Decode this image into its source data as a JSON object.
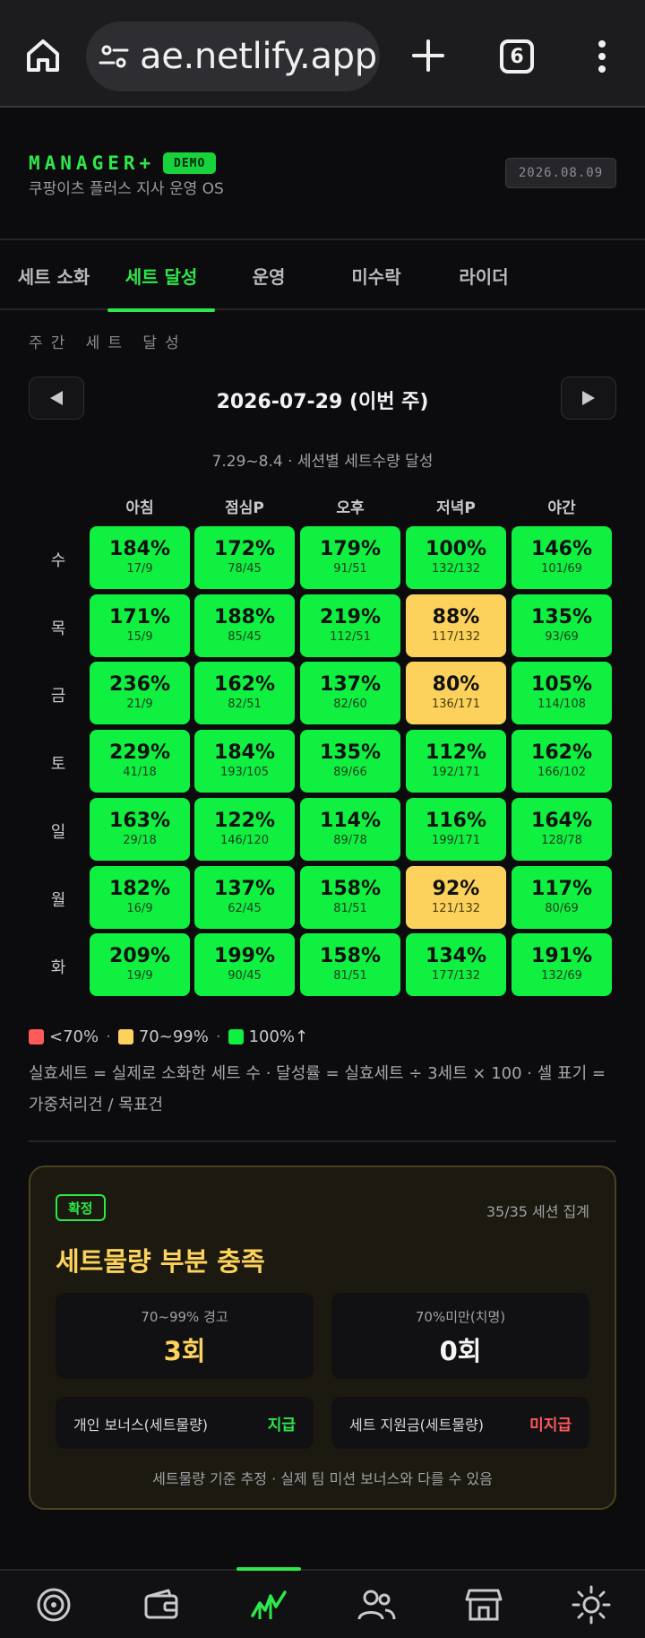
{
  "browser": {
    "url": "ae.netlify.app",
    "tab_count": "6"
  },
  "app": {
    "brand": "MANAGER+",
    "badge": "DEMO",
    "subtitle": "쿠팡이츠 플러스 지사 운영 OS",
    "date": "2026.08.09"
  },
  "tabs": [
    {
      "label": "세트 소화",
      "active": false
    },
    {
      "label": "세트 달성",
      "active": true
    },
    {
      "label": "운영",
      "active": false
    },
    {
      "label": "미수락",
      "active": false
    },
    {
      "label": "라이더",
      "active": false
    }
  ],
  "section": {
    "label": "주간 세트 달성",
    "week_title": "2026-07-29 (이번 주)",
    "range_subtitle": "7.29~8.4 · 세션별 세트수량 달성"
  },
  "grid": {
    "columns": [
      "아침",
      "점심P",
      "오후",
      "저녁P",
      "야간"
    ],
    "rows": [
      {
        "day": "수",
        "cells": [
          {
            "pct": "184%",
            "ratio": "17/9",
            "status": "green"
          },
          {
            "pct": "172%",
            "ratio": "78/45",
            "status": "green"
          },
          {
            "pct": "179%",
            "ratio": "91/51",
            "status": "green"
          },
          {
            "pct": "100%",
            "ratio": "132/132",
            "status": "green"
          },
          {
            "pct": "146%",
            "ratio": "101/69",
            "status": "green"
          }
        ]
      },
      {
        "day": "목",
        "cells": [
          {
            "pct": "171%",
            "ratio": "15/9",
            "status": "green"
          },
          {
            "pct": "188%",
            "ratio": "85/45",
            "status": "green"
          },
          {
            "pct": "219%",
            "ratio": "112/51",
            "status": "green"
          },
          {
            "pct": "88%",
            "ratio": "117/132",
            "status": "yellow"
          },
          {
            "pct": "135%",
            "ratio": "93/69",
            "status": "green"
          }
        ]
      },
      {
        "day": "금",
        "cells": [
          {
            "pct": "236%",
            "ratio": "21/9",
            "status": "green"
          },
          {
            "pct": "162%",
            "ratio": "82/51",
            "status": "green"
          },
          {
            "pct": "137%",
            "ratio": "82/60",
            "status": "green"
          },
          {
            "pct": "80%",
            "ratio": "136/171",
            "status": "yellow"
          },
          {
            "pct": "105%",
            "ratio": "114/108",
            "status": "green"
          }
        ]
      },
      {
        "day": "토",
        "cells": [
          {
            "pct": "229%",
            "ratio": "41/18",
            "status": "green"
          },
          {
            "pct": "184%",
            "ratio": "193/105",
            "status": "green"
          },
          {
            "pct": "135%",
            "ratio": "89/66",
            "status": "green"
          },
          {
            "pct": "112%",
            "ratio": "192/171",
            "status": "green"
          },
          {
            "pct": "162%",
            "ratio": "166/102",
            "status": "green"
          }
        ]
      },
      {
        "day": "일",
        "cells": [
          {
            "pct": "163%",
            "ratio": "29/18",
            "status": "green"
          },
          {
            "pct": "122%",
            "ratio": "146/120",
            "status": "green"
          },
          {
            "pct": "114%",
            "ratio": "89/78",
            "status": "green"
          },
          {
            "pct": "116%",
            "ratio": "199/171",
            "status": "green"
          },
          {
            "pct": "164%",
            "ratio": "128/78",
            "status": "green"
          }
        ]
      },
      {
        "day": "월",
        "cells": [
          {
            "pct": "182%",
            "ratio": "16/9",
            "status": "green"
          },
          {
            "pct": "137%",
            "ratio": "62/45",
            "status": "green"
          },
          {
            "pct": "158%",
            "ratio": "81/51",
            "status": "green"
          },
          {
            "pct": "92%",
            "ratio": "121/132",
            "status": "yellow"
          },
          {
            "pct": "117%",
            "ratio": "80/69",
            "status": "green"
          }
        ]
      },
      {
        "day": "화",
        "cells": [
          {
            "pct": "209%",
            "ratio": "19/9",
            "status": "green"
          },
          {
            "pct": "199%",
            "ratio": "90/45",
            "status": "green"
          },
          {
            "pct": "158%",
            "ratio": "81/51",
            "status": "green"
          },
          {
            "pct": "134%",
            "ratio": "177/132",
            "status": "green"
          },
          {
            "pct": "191%",
            "ratio": "132/69",
            "status": "green"
          }
        ]
      }
    ]
  },
  "legend": {
    "red": "<70%",
    "yellow": "70~99%",
    "green": "100%↑",
    "sep": "·",
    "colors": {
      "red": "#ff5a5a",
      "yellow": "#fcd25c",
      "green": "#10f040"
    }
  },
  "note": "실효세트 = 실제로 소화한 세트 수 · 달성률 = 실효세트 ÷ 3세트 × 100 · 셀 표기 = 가중처리건 / 목표건",
  "summary": {
    "badge": "확정",
    "aggregate": "35/35 세션 집계",
    "title": "세트물량 부분 충족",
    "warn_label": "70~99% 경고",
    "warn_value": "3회",
    "fatal_label": "70%미만(치명)",
    "fatal_value": "0회",
    "bonus_label": "개인 보너스(세트물량)",
    "bonus_value": "지급",
    "support_label": "세트 지원금(세트물량)",
    "support_value": "미지급",
    "footnote": "세트물량 기준 추정 · 실제 팀 미션 보너스와 다를 수 있음"
  },
  "bottom_nav": [
    "target-icon",
    "wallet-icon",
    "chart-icon",
    "users-icon",
    "store-icon",
    "sun-icon"
  ]
}
